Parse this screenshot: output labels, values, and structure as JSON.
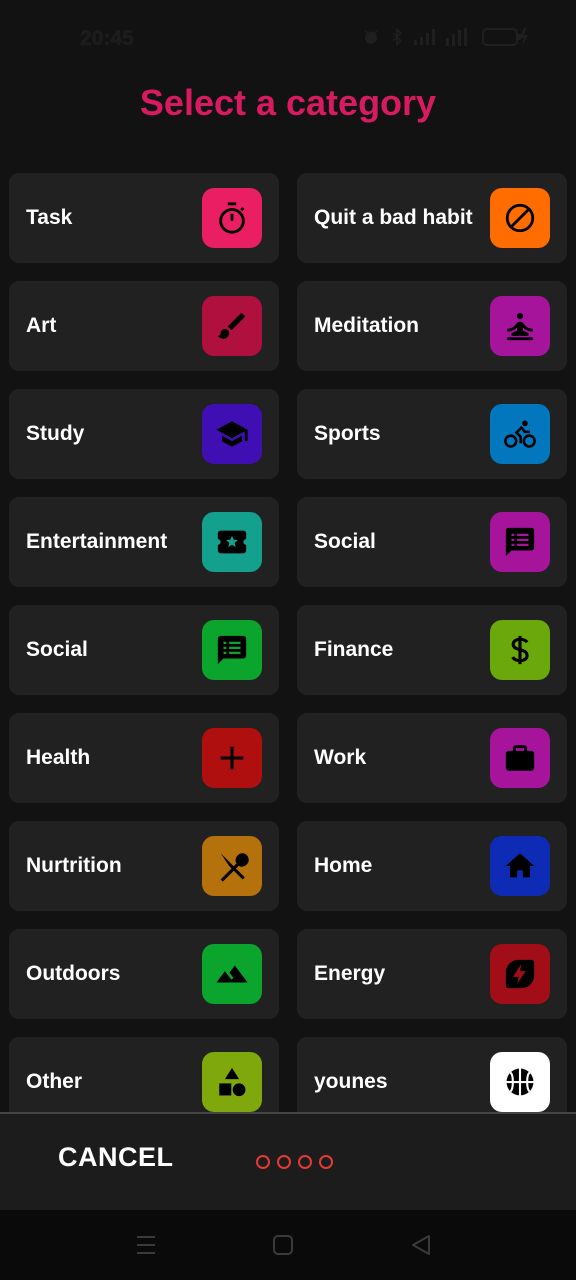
{
  "status_bar": {
    "time": "20:45",
    "battery": "55"
  },
  "title": "Select a category",
  "categories": [
    {
      "label": "Task",
      "icon": "stopwatch-icon",
      "color": "#e91e63"
    },
    {
      "label": "Quit a bad habit",
      "icon": "block-icon",
      "color": "#ff6d00"
    },
    {
      "label": "Art",
      "icon": "brush-icon",
      "color": "#b0103e"
    },
    {
      "label": "Meditation",
      "icon": "meditation-icon",
      "color": "#a6149b"
    },
    {
      "label": "Study",
      "icon": "graduation-cap-icon",
      "color": "#3f0fb3"
    },
    {
      "label": "Sports",
      "icon": "bicycle-icon",
      "color": "#0277bd"
    },
    {
      "label": "Entertainment",
      "icon": "ticket-star-icon",
      "color": "#13a08c"
    },
    {
      "label": "Social",
      "icon": "chat-icon",
      "color": "#a6149b"
    },
    {
      "label": "Social",
      "icon": "chat-icon",
      "color": "#0ba52e"
    },
    {
      "label": "Finance",
      "icon": "dollar-icon",
      "color": "#6aa80c"
    },
    {
      "label": "Health",
      "icon": "plus-icon",
      "color": "#b00f0f"
    },
    {
      "label": "Work",
      "icon": "briefcase-icon",
      "color": "#a6149b"
    },
    {
      "label": "Nurtrition",
      "icon": "utensils-icon",
      "color": "#b5710c"
    },
    {
      "label": "Home",
      "icon": "home-icon",
      "color": "#0d2bb5"
    },
    {
      "label": "Outdoors",
      "icon": "mountains-icon",
      "color": "#0ba52e"
    },
    {
      "label": "Energy",
      "icon": "energy-icon",
      "color": "#a10e17"
    },
    {
      "label": "Other",
      "icon": "shapes-icon",
      "color": "#7fa80c"
    },
    {
      "label": "younes",
      "icon": "basketball-icon",
      "color": "#ffffff"
    }
  ],
  "footer": {
    "cancel_label": "CANCEL",
    "page_dots": 4
  }
}
